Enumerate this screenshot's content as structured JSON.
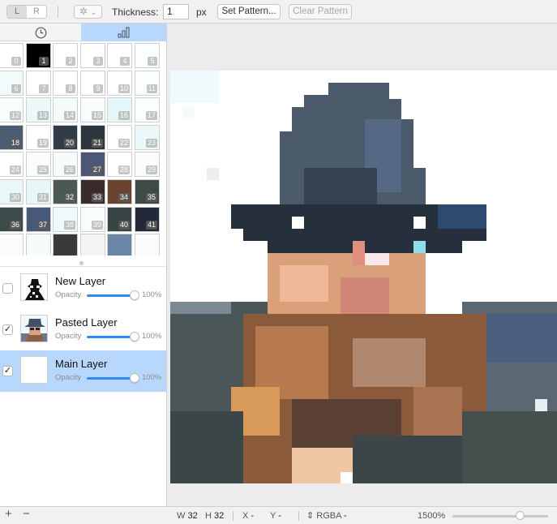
{
  "toolbar": {
    "mode_left": "L",
    "mode_right": "R",
    "gear_caret": "⌄",
    "thickness_label": "Thickness:",
    "thickness_value": "1",
    "thickness_unit": "px",
    "set_pattern": "Set Pattern...",
    "clear_pattern": "Clear Pattern"
  },
  "sidebar": {
    "tabs": [
      {
        "icon": "history-clock-icon",
        "active": false
      },
      {
        "icon": "bar-chart-icon",
        "active": true
      }
    ]
  },
  "palette": [
    {
      "n": "0",
      "c": "#ffffff"
    },
    {
      "n": "1",
      "c": "#000000"
    },
    {
      "n": "2",
      "c": "#ffffff"
    },
    {
      "n": "3",
      "c": "#ffffff"
    },
    {
      "n": "4",
      "c": "#ffffff"
    },
    {
      "n": "5",
      "c": "#fafefe"
    },
    {
      "n": "6",
      "c": "#f2fbfb"
    },
    {
      "n": "7",
      "c": "#ffffff"
    },
    {
      "n": "8",
      "c": "#ffffff"
    },
    {
      "n": "9",
      "c": "#ffffff"
    },
    {
      "n": "10",
      "c": "#ffffff"
    },
    {
      "n": "11",
      "c": "#fbfefe"
    },
    {
      "n": "12",
      "c": "#fafdfd"
    },
    {
      "n": "13",
      "c": "#ecf9f8"
    },
    {
      "n": "14",
      "c": "#f4fbfb"
    },
    {
      "n": "15",
      "c": "#fafdfd"
    },
    {
      "n": "16",
      "c": "#e4f6f7"
    },
    {
      "n": "17",
      "c": "#fbfefe"
    },
    {
      "n": "18",
      "c": "#4b5b72"
    },
    {
      "n": "19",
      "c": "#ffffff"
    },
    {
      "n": "20",
      "c": "#2f3c47"
    },
    {
      "n": "21",
      "c": "#2c353b"
    },
    {
      "n": "22",
      "c": "#ffffff"
    },
    {
      "n": "23",
      "c": "#eaf8f9"
    },
    {
      "n": "24",
      "c": "#ffffff"
    },
    {
      "n": "25",
      "c": "#fbfdfd"
    },
    {
      "n": "26",
      "c": "#f6fbfb"
    },
    {
      "n": "27",
      "c": "#4b5775"
    },
    {
      "n": "28",
      "c": "#ffffff"
    },
    {
      "n": "29",
      "c": "#fbfdfd"
    },
    {
      "n": "30",
      "c": "#e9f7f8"
    },
    {
      "n": "31",
      "c": "#e6f7f8"
    },
    {
      "n": "32",
      "c": "#4a5856"
    },
    {
      "n": "33",
      "c": "#3a2c28"
    },
    {
      "n": "34",
      "c": "#6b4430"
    },
    {
      "n": "35",
      "c": "#3d4a48"
    },
    {
      "n": "36",
      "c": "#3c4a4a"
    },
    {
      "n": "37",
      "c": "#485878"
    },
    {
      "n": "38",
      "c": "#eef9f9"
    },
    {
      "n": "39",
      "c": "#f8fcfc"
    },
    {
      "n": "40",
      "c": "#384544"
    },
    {
      "n": "41",
      "c": "#222a3a"
    }
  ],
  "layers": [
    {
      "name": "New Layer",
      "checked": false,
      "selected": false,
      "opacity_label": "Opacity",
      "opacity_value": "100%",
      "opacity": 1.0,
      "check": ""
    },
    {
      "name": "Pasted Layer",
      "checked": true,
      "selected": false,
      "opacity_label": "Opacity",
      "opacity_value": "100%",
      "opacity": 1.0,
      "check": "✓"
    },
    {
      "name": "Main Layer",
      "checked": true,
      "selected": true,
      "opacity_label": "Opacity",
      "opacity_value": "100%",
      "opacity": 1.0,
      "check": "✓"
    }
  ],
  "statusbar": {
    "add": "+",
    "remove": "−",
    "w_label": "W",
    "w_value": "32",
    "h_label": "H",
    "h_value": "32",
    "x_label": "X",
    "x_value": "-",
    "y_label": "Y",
    "y_value": "-",
    "format_arrows": "⇕",
    "format_label": "RGBA",
    "format_value": "-",
    "zoom": "1500%",
    "zoom_fraction": 0.7
  }
}
